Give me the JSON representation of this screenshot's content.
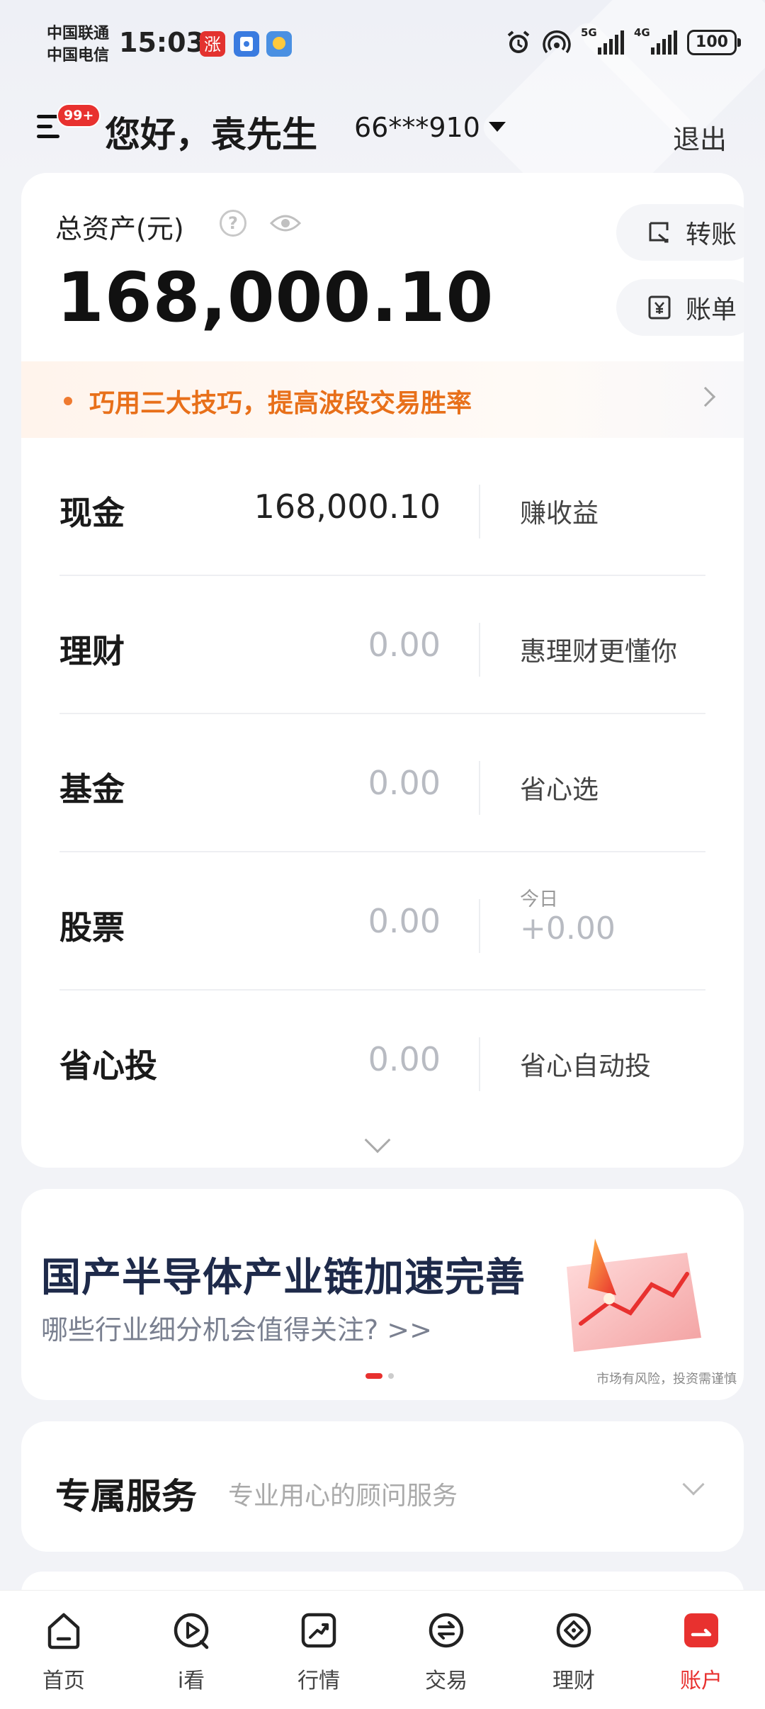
{
  "status_bar": {
    "carrier_1": "中国联通",
    "carrier_2": "中国电信",
    "time": "15:03",
    "signal_1_tag": "5G",
    "signal_2_tag": "4G",
    "battery": "100"
  },
  "header": {
    "badge": "99+",
    "greeting": "您好，袁先生",
    "account": "66***910",
    "logout": "退出"
  },
  "asset": {
    "label": "总资产(元)",
    "value": "168,000.10",
    "transfer_label": "转账",
    "bill_label": "账单",
    "tip": "巧用三大技巧，提高波段交易胜率"
  },
  "rows": [
    {
      "name": "现金",
      "amount": "168,000.10",
      "side": "赚收益"
    },
    {
      "name": "理财",
      "amount": "0.00",
      "side": "惠理财更懂你"
    },
    {
      "name": "基金",
      "amount": "0.00",
      "side": "省心选"
    },
    {
      "name": "股票",
      "amount": "0.00",
      "side_small": "今日",
      "side_value": "+0.00"
    },
    {
      "name": "省心投",
      "amount": "0.00",
      "side": "省心自动投"
    }
  ],
  "banner": {
    "title": "国产半导体产业链加速完善",
    "subtitle": "哪些行业细分机会值得关注? >>",
    "note": "市场有风险，投资需谨慎"
  },
  "service": {
    "title": "专属服务",
    "subtitle": "专业用心的顾问服务"
  },
  "tabs": [
    {
      "label": "首页",
      "icon": "home-icon"
    },
    {
      "label": "i看",
      "icon": "play-icon"
    },
    {
      "label": "行情",
      "icon": "trend-icon"
    },
    {
      "label": "交易",
      "icon": "exchange-icon"
    },
    {
      "label": "理财",
      "icon": "wealth-icon"
    },
    {
      "label": "账户",
      "icon": "account-icon"
    }
  ],
  "colors": {
    "accent": "#e8312f",
    "tip_text": "#e8701a",
    "banner_title": "#1e2a4a"
  }
}
